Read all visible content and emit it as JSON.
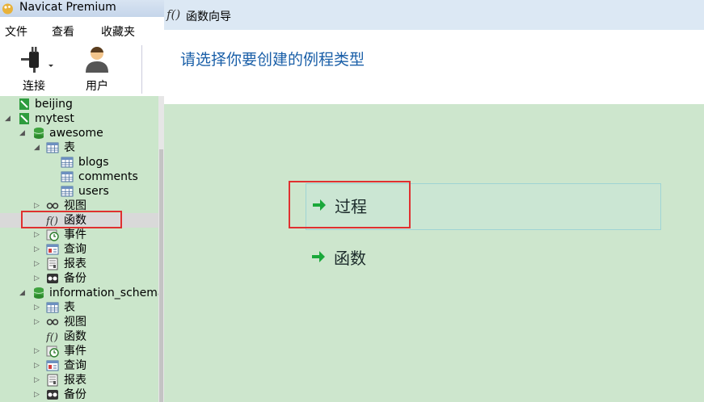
{
  "app": {
    "title": "Navicat Premium"
  },
  "menu": [
    "文件",
    "查看",
    "收藏夹"
  ],
  "toolbar": {
    "connect_label": "连接",
    "user_label": "用户"
  },
  "tree": [
    {
      "label": "beijing",
      "level": 0,
      "icon": "connection-icon",
      "expander": ""
    },
    {
      "label": "mytest",
      "level": 0,
      "icon": "connection-icon",
      "expander": "◢"
    },
    {
      "label": "awesome",
      "level": 1,
      "icon": "database-icon",
      "expander": "◢"
    },
    {
      "label": "表",
      "level": 2,
      "icon": "table-icon",
      "expander": "◢"
    },
    {
      "label": "blogs",
      "level": 3,
      "icon": "table-icon",
      "expander": ""
    },
    {
      "label": "comments",
      "level": 3,
      "icon": "table-icon",
      "expander": ""
    },
    {
      "label": "users",
      "level": 3,
      "icon": "table-icon",
      "expander": ""
    },
    {
      "label": "视图",
      "level": 2,
      "icon": "view-icon",
      "expander": "▷"
    },
    {
      "label": "函数",
      "level": 2,
      "icon": "function-icon",
      "expander": "",
      "selected": true
    },
    {
      "label": "事件",
      "level": 2,
      "icon": "event-icon",
      "expander": "▷"
    },
    {
      "label": "查询",
      "level": 2,
      "icon": "query-icon",
      "expander": "▷"
    },
    {
      "label": "报表",
      "level": 2,
      "icon": "report-icon",
      "expander": "▷"
    },
    {
      "label": "备份",
      "level": 2,
      "icon": "backup-icon",
      "expander": "▷"
    },
    {
      "label": "information_schema",
      "level": 1,
      "icon": "database-icon",
      "expander": "◢"
    },
    {
      "label": "表",
      "level": 2,
      "icon": "table-icon",
      "expander": "▷"
    },
    {
      "label": "视图",
      "level": 2,
      "icon": "view-icon",
      "expander": "▷"
    },
    {
      "label": "函数",
      "level": 2,
      "icon": "function-icon",
      "expander": ""
    },
    {
      "label": "事件",
      "level": 2,
      "icon": "event-icon",
      "expander": "▷"
    },
    {
      "label": "查询",
      "level": 2,
      "icon": "query-icon",
      "expander": "▷"
    },
    {
      "label": "报表",
      "level": 2,
      "icon": "report-icon",
      "expander": "▷"
    },
    {
      "label": "备份",
      "level": 2,
      "icon": "backup-icon",
      "expander": "▷"
    }
  ],
  "dialog": {
    "title": "函数向导",
    "heading": "请选择你要创建的例程类型",
    "options": [
      "过程",
      "函数"
    ]
  }
}
